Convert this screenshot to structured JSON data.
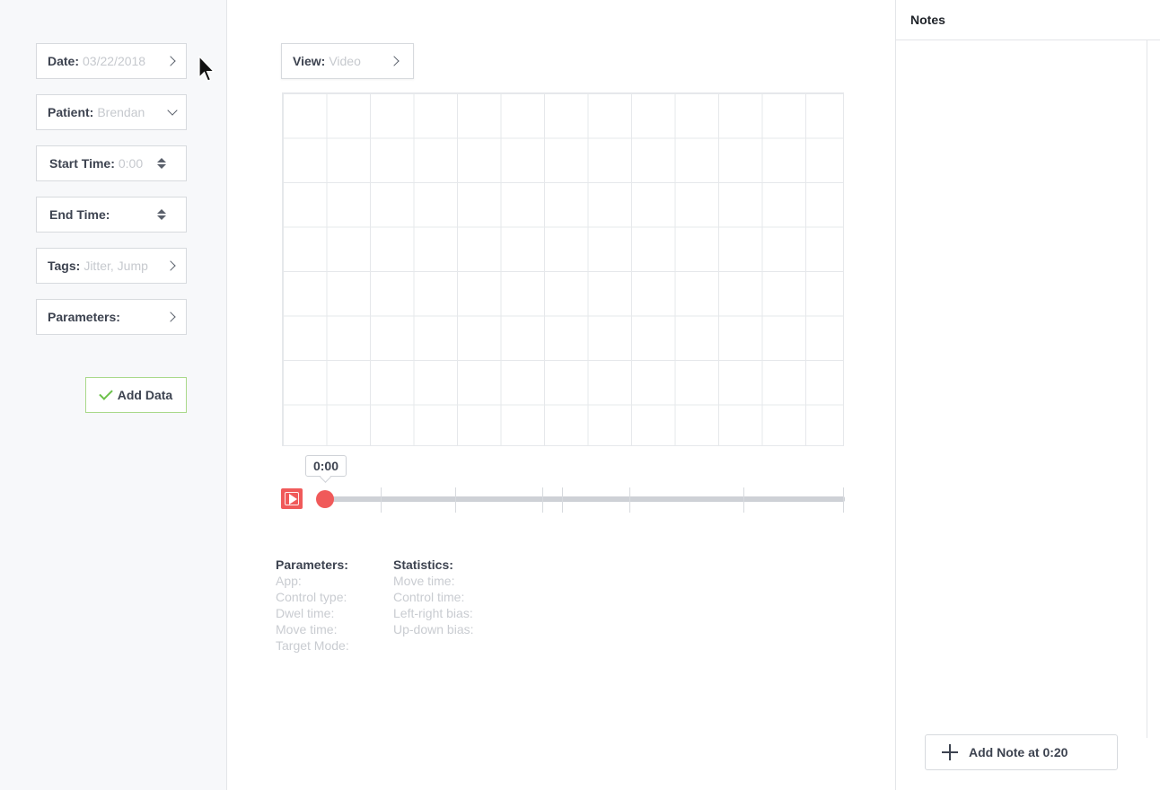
{
  "sidebar": {
    "date": {
      "label": "Date:",
      "value": "03/22/2018"
    },
    "patient": {
      "label": "Patient:",
      "value": "Brendan"
    },
    "start_time": {
      "label": "Start Time:",
      "value": "0:00"
    },
    "end_time": {
      "label": "End Time:",
      "value": ""
    },
    "tags": {
      "label": "Tags:",
      "value": "Jitter, Jump"
    },
    "parameters": {
      "label": "Parameters:",
      "value": ""
    },
    "add_data_label": "Add Data"
  },
  "main": {
    "view": {
      "label": "View:",
      "value": "Video"
    },
    "player": {
      "current_time": "0:00",
      "progress": 0
    },
    "parameters": {
      "heading": "Parameters:",
      "rows": [
        "App:",
        "Control type:",
        "Dwel time:",
        "Move time:",
        "Target Mode:"
      ]
    },
    "statistics": {
      "heading": "Statistics:",
      "rows": [
        "Move time:",
        "Control time:",
        "Left-right bias:",
        "Up-down bias:"
      ]
    }
  },
  "notes": {
    "title": "Notes",
    "add_note_label": "Add Note at 0:20"
  },
  "colors": {
    "accent": "#f05a5a",
    "success": "#6cc14a",
    "placeholder": "#c6c9ce"
  }
}
